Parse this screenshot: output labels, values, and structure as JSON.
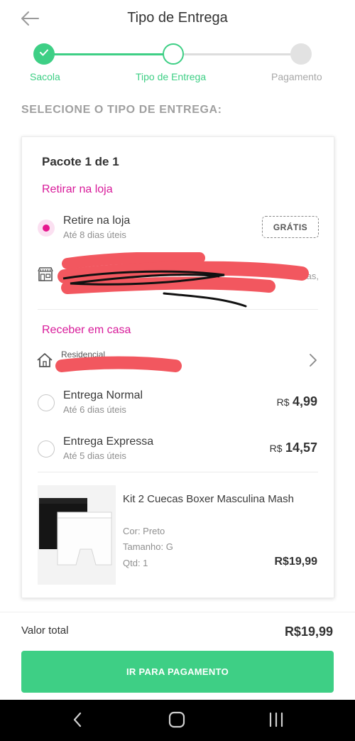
{
  "header": {
    "title": "Tipo de Entrega",
    "back_icon": "arrow-left-icon"
  },
  "stepper": {
    "steps": [
      {
        "label": "Sacola",
        "status": "done"
      },
      {
        "label": "Tipo de Entrega",
        "status": "current"
      },
      {
        "label": "Pagamento",
        "status": "pending"
      }
    ]
  },
  "section_title": "SELECIONE O TIPO DE ENTREGA:",
  "package": {
    "title": "Pacote 1 de 1",
    "pickup": {
      "heading": "Retirar na loja",
      "option_title": "Retire na loja",
      "option_sub": "Até 8 dias úteis",
      "badge": "GRÁTIS",
      "address_tail": "otas,"
    },
    "home": {
      "heading": "Receber em casa",
      "address_label": "Residencial",
      "options": [
        {
          "title": "Entrega Normal",
          "sub": "Até 6 dias úteis",
          "currency": "R$",
          "price": "4,99"
        },
        {
          "title": "Entrega Expressa",
          "sub": "Até 5 dias úteis",
          "currency": "R$",
          "price": "14,57"
        }
      ]
    },
    "product": {
      "name": "Kit 2 Cuecas Boxer Masculina Mash",
      "color": "Cor: Preto",
      "size": "Tamanho: G",
      "qty": "Qtd: 1",
      "price": "R$19,99"
    }
  },
  "footer": {
    "total_label": "Valor total",
    "total_value": "R$19,99",
    "button_label": "IR PARA PAGAMENTO"
  },
  "colors": {
    "accent": "#3ecf85",
    "pink": "#d81b9a",
    "redaction": "#f2575f"
  }
}
